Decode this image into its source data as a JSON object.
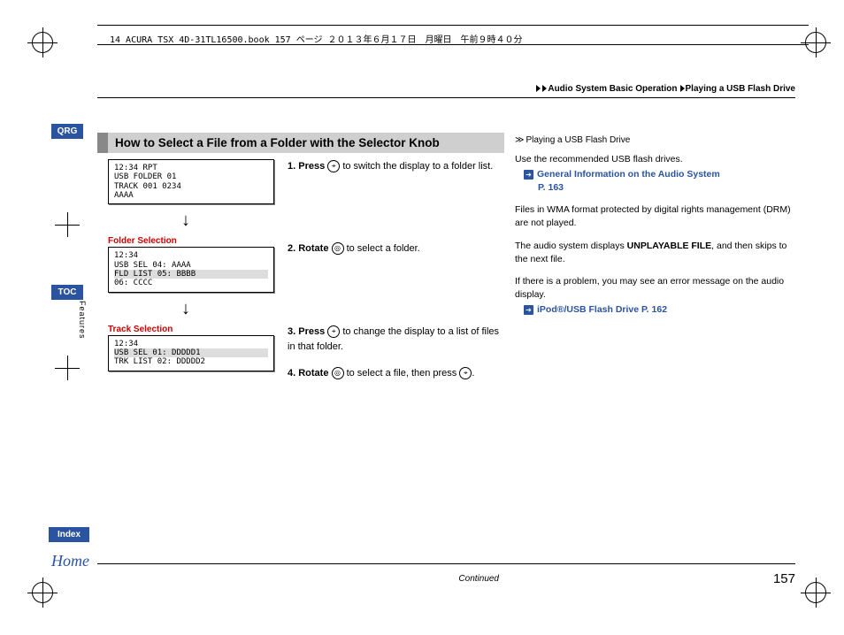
{
  "header": {
    "filename_line": "14 ACURA TSX 4D-31TL16500.book  157 ページ  ２０１３年６月１７日　月曜日　午前９時４０分"
  },
  "breadcrumb": {
    "level1": "Audio System Basic Operation",
    "level2": "Playing a USB Flash Drive"
  },
  "nav": {
    "qrg": "QRG",
    "toc": "TOC",
    "features": "Features",
    "index": "Index",
    "home": "Home"
  },
  "main": {
    "title": "How to Select a File from a Folder with the Selector Knob",
    "display1": {
      "l1": "12:34             RPT",
      "l2": " USB      FOLDER 01",
      "l3": "          TRACK 001   0234",
      "l4": "          AAAA"
    },
    "caption1": "Folder Selection",
    "display2": {
      "l1": "12:34",
      "l2": " USB  SEL    04: AAAA",
      "l3": " FLD LIST    05: BBBB",
      "l4": "             06: CCCC"
    },
    "caption2": "Track Selection",
    "display3": {
      "l1": "12:34",
      "l2": " USB  SEL    01: DDDDD1",
      "l3": " TRK LIST    02: DDDDD2"
    },
    "arrow": "↓",
    "step1a": "1. Press ",
    "step1b": " to switch the display to a folder list.",
    "step2a": "2. Rotate ",
    "step2b": " to select a folder.",
    "step3a": "3. Press ",
    "step3b": " to change the display to a list of files in that folder.",
    "step4a": "4. Rotate ",
    "step4b": " to select a file, then press ",
    "step4c": ".",
    "icon_press": "⌖",
    "icon_rotate": "◎"
  },
  "aside": {
    "title": "Playing a USB Flash Drive",
    "p1": "Use the recommended USB flash drives.",
    "link1": "General Information on the Audio System",
    "link1_page": "P. 163",
    "p2": "Files in WMA format protected by digital rights management (DRM) are not played.",
    "p3a": "The audio system displays ",
    "p3b": "UNPLAYABLE FILE",
    "p3c": ", and then skips to the next file.",
    "p4": "If there is a problem, you may see an error message on the audio display.",
    "link2": "iPod®/USB Flash Drive",
    "link2_page": "P. 162"
  },
  "footer": {
    "continued": "Continued",
    "page": "157"
  }
}
